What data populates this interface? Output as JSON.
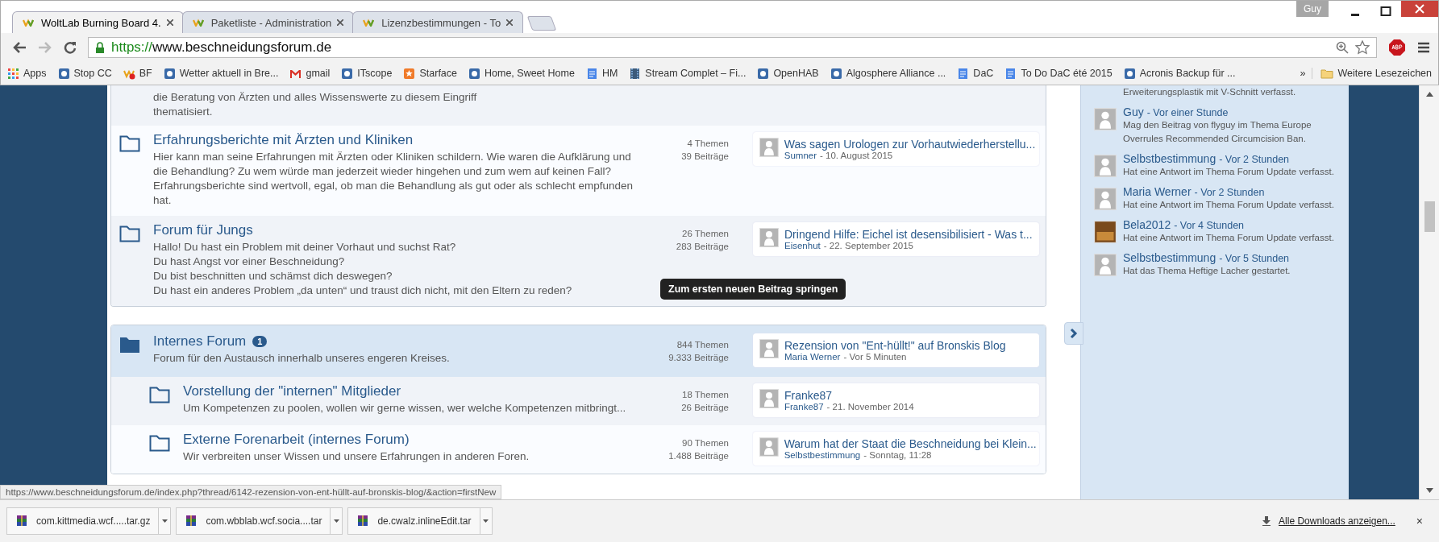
{
  "browser": {
    "profile": "Guy",
    "tabs": [
      {
        "title": "WoltLab Burning Board 4.",
        "selected": true
      },
      {
        "title": "Paketliste - Administration",
        "selected": false
      },
      {
        "title": "Lizenzbestimmungen - To",
        "selected": false
      }
    ],
    "url_scheme": "https://",
    "url_host": "www.beschneidungsforum.de",
    "bookmarks": [
      {
        "label": "Apps",
        "kind": "apps"
      },
      {
        "label": "Stop CC",
        "kind": "page"
      },
      {
        "label": "BF",
        "kind": "wbb"
      },
      {
        "label": "Wetter aktuell in Bre...",
        "kind": "page"
      },
      {
        "label": "gmail",
        "kind": "mail"
      },
      {
        "label": "ITscope",
        "kind": "page"
      },
      {
        "label": "Starface",
        "kind": "star"
      },
      {
        "label": "Home, Sweet Home",
        "kind": "page"
      },
      {
        "label": "HM",
        "kind": "doc"
      },
      {
        "label": "Stream Complet – Fi...",
        "kind": "film"
      },
      {
        "label": "OpenHAB",
        "kind": "page"
      },
      {
        "label": "Algosphere Alliance ...",
        "kind": "page"
      },
      {
        "label": "DaC",
        "kind": "doc"
      },
      {
        "label": "To Do DaC été 2015",
        "kind": "doc"
      },
      {
        "label": "Acronis Backup für ...",
        "kind": "page"
      }
    ],
    "bookmarks_overflow": "»",
    "other_bookmarks": "Weitere Lesezeichen"
  },
  "forum": {
    "cut_description": [
      "die Beratung von Ärzten und alles Wissenswerte zu diesem Eingriff",
      "thematisiert."
    ],
    "boards": [
      {
        "title": "Erfahrungsberichte mit Ärzten und Kliniken",
        "has_new": false,
        "description": [
          "Hier kann man seine Erfahrungen mit Ärzten oder Kliniken schildern. Wie waren die Aufklärung und die Behandlung? Zu wem würde man jederzeit wieder hingehen und zum wem auf keinen Fall? Erfahrungsberichte sind wertvoll, egal, ob man die Behandlung als gut oder als schlecht empfunden hat."
        ],
        "themes": "4 Themen",
        "posts": "39 Beiträge",
        "last_post": {
          "title": "Was sagen Urologen zur Vorhautwiederherstellu...",
          "author": "Sumner",
          "time": "- 10. August 2015"
        }
      },
      {
        "title": "Forum für Jungs",
        "has_new": false,
        "description": [
          "Hallo! Du hast ein Problem mit deiner Vorhaut und suchst Rat?",
          "Du hast Angst vor einer Beschneidung?",
          "Du bist beschnitten und schämst dich deswegen?",
          "Du hast ein anderes Problem „da unten“ und traust dich nicht, mit den Eltern zu reden?"
        ],
        "themes": "26 Themen",
        "posts": "283 Beiträge",
        "last_post": {
          "title": "Dringend Hilfe: Eichel ist desensibilisiert - Was t...",
          "author": "Eisenhut",
          "time": "- 22. September 2015"
        }
      }
    ],
    "category": {
      "title": "Internes Forum",
      "badge": "1",
      "has_new": true,
      "description": [
        "Forum für den Austausch innerhalb unseres engeren Kreises."
      ],
      "themes": "844 Themen",
      "posts": "9.333 Beiträge",
      "last_post": {
        "title": "Rezension von \"Ent-hüllt!\" auf Bronskis Blog",
        "author": "Maria Werner",
        "time": "- Vor 5 Minuten"
      },
      "children": [
        {
          "title": "Vorstellung der \"internen\" Mitglieder",
          "has_new": false,
          "description": [
            "Um Kompetenzen zu poolen, wollen wir gerne wissen, wer welche Kompetenzen mitbringt..."
          ],
          "themes": "18 Themen",
          "posts": "26 Beiträge",
          "last_post": {
            "title": "Franke87",
            "author": "Franke87",
            "time": "- 21. November 2014"
          }
        },
        {
          "title": "Externe Forenarbeit (internes Forum)",
          "has_new": false,
          "description": [
            "Wir verbreiten unser Wissen und unsere Erfahrungen in anderen Foren."
          ],
          "themes": "90 Themen",
          "posts": "1.488 Beiträge",
          "last_post": {
            "title": "Warum hat der Staat die Beschneidung bei Klein...",
            "author": "Selbstbestimmung",
            "time": "- Sonntag, 11:28"
          }
        }
      ]
    },
    "tooltip": "Zum ersten neuen Beitrag springen"
  },
  "sidebar": {
    "cut_text": "Erweiterungsplastik mit V-Schnitt verfasst.",
    "activities": [
      {
        "user": "Guy",
        "time": "- Vor einer Stunde",
        "text": "Mag den Beitrag von flyguy im Thema Europe Overrules Recommended Circumcision Ban.",
        "kind": "default"
      },
      {
        "user": "Selbstbestimmung",
        "time": "- Vor 2 Stunden",
        "text": "Hat eine Antwort im Thema Forum Update verfasst.",
        "kind": "default"
      },
      {
        "user": "Maria Werner",
        "time": "- Vor 2 Stunden",
        "text": "Hat eine Antwort im Thema Forum Update verfasst.",
        "kind": "default"
      },
      {
        "user": "Bela2012",
        "time": "- Vor 4 Stunden",
        "text": "Hat eine Antwort im Thema Forum Update verfasst.",
        "kind": "photo"
      },
      {
        "user": "Selbstbestimmung",
        "time": "- Vor 5 Stunden",
        "text": "Hat das Thema Heftige Lacher gestartet.",
        "kind": "default"
      }
    ]
  },
  "status_url": "https://www.beschneidungsforum.de/index.php?thread/6142-rezension-von-ent-hüllt-auf-bronskis-blog/&action=firstNew",
  "downloads": {
    "items": [
      {
        "name": "com.kittmedia.wcf.....tar.gz"
      },
      {
        "name": "com.wbblab.wcf.socia....tar"
      },
      {
        "name": "de.cwalz.inlineEdit.tar"
      }
    ],
    "show_all": "Alle Downloads anzeigen...",
    "close": "×"
  }
}
